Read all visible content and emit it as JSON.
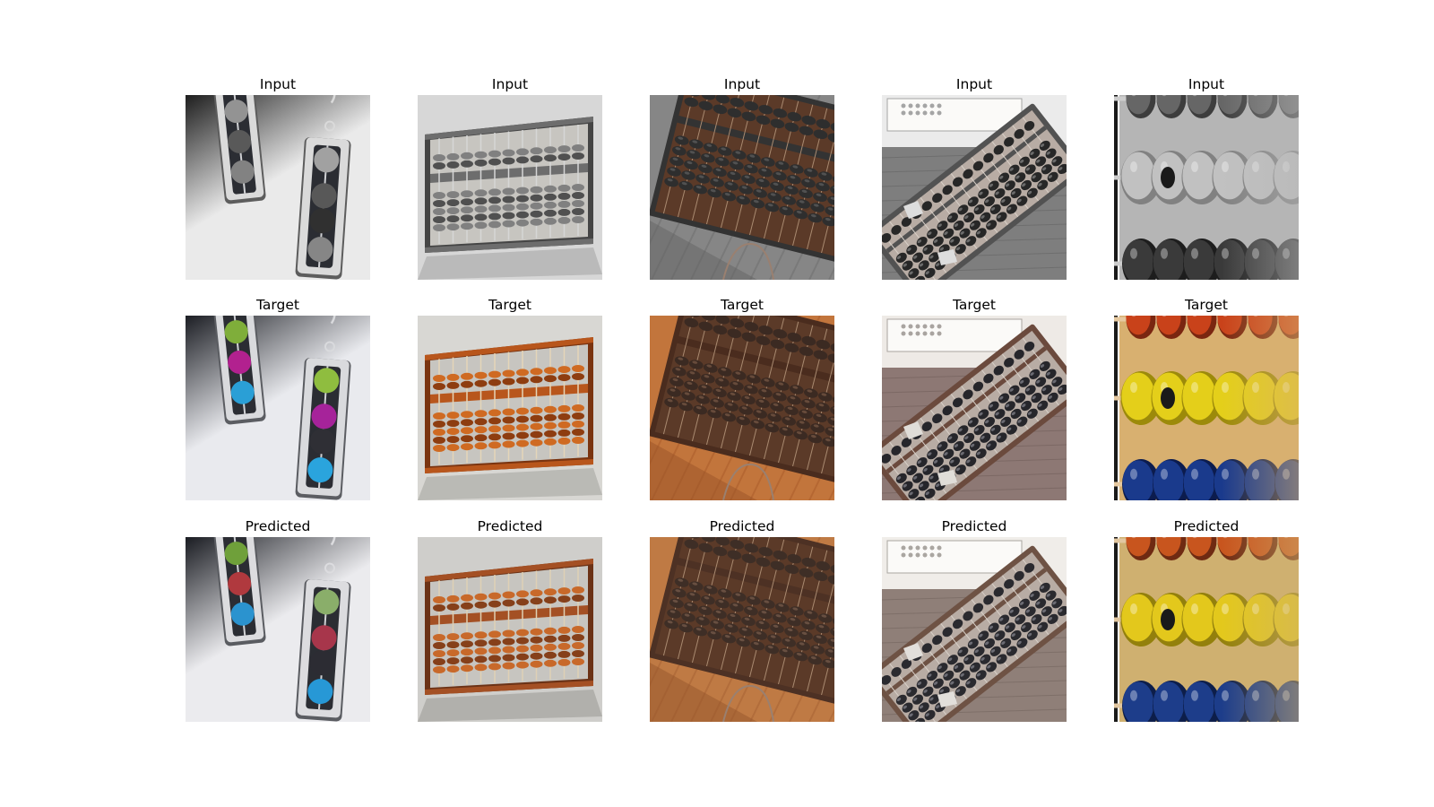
{
  "figure": {
    "rows": [
      {
        "title": "Input",
        "mode": "gray",
        "panels": [
          {
            "subject": "earrings-abacus-pendants",
            "title": "Input"
          },
          {
            "subject": "wooden-abacus-on-table",
            "title": "Input"
          },
          {
            "subject": "abacus-on-wood-floor",
            "title": "Input"
          },
          {
            "subject": "abacus-on-desk",
            "title": "Input"
          },
          {
            "subject": "abacus-bead-closeup",
            "title": "Input"
          }
        ]
      },
      {
        "title": "Target",
        "mode": "target",
        "panels": [
          {
            "subject": "earrings-abacus-pendants",
            "title": "Target"
          },
          {
            "subject": "wooden-abacus-on-table",
            "title": "Target"
          },
          {
            "subject": "abacus-on-wood-floor",
            "title": "Target"
          },
          {
            "subject": "abacus-on-desk",
            "title": "Target"
          },
          {
            "subject": "abacus-bead-closeup",
            "title": "Target"
          }
        ]
      },
      {
        "title": "Predicted",
        "mode": "predicted",
        "panels": [
          {
            "subject": "earrings-abacus-pendants",
            "title": "Predicted"
          },
          {
            "subject": "wooden-abacus-on-table",
            "title": "Predicted"
          },
          {
            "subject": "abacus-on-wood-floor",
            "title": "Predicted"
          },
          {
            "subject": "abacus-on-desk",
            "title": "Predicted"
          },
          {
            "subject": "abacus-bead-closeup",
            "title": "Predicted"
          }
        ]
      }
    ],
    "colors": {
      "title_text": "#000000",
      "background": "#ffffff"
    }
  }
}
